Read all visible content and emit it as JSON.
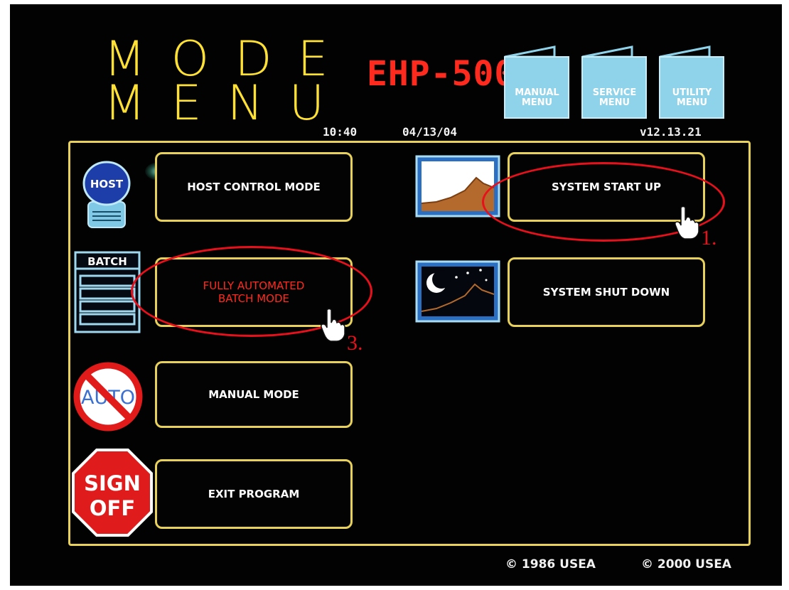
{
  "header": {
    "title_line1": "MODE",
    "title_line2": "MENU",
    "model": "EHP-500",
    "time": "10:40",
    "date": "04/13/04",
    "version": "v12.13.21"
  },
  "top_menus": [
    {
      "label": "MANUAL\nMENU"
    },
    {
      "label": "SERVICE\nMENU"
    },
    {
      "label": "UTILITY\nMENU"
    }
  ],
  "modes": {
    "host": {
      "label": "HOST CONTROL MODE",
      "icon_label": "HOST",
      "icon": "host-computer-icon"
    },
    "batch": {
      "label": "FULLY AUTOMATED\nBATCH MODE",
      "icon_label": "BATCH",
      "icon": "batch-list-icon"
    },
    "manual": {
      "label": "MANUAL MODE",
      "icon_label": "AUTO",
      "icon": "no-auto-icon"
    },
    "exit": {
      "label": "EXIT PROGRAM",
      "icon_label_1": "SIGN",
      "icon_label_2": "OFF",
      "icon": "stop-sign-icon"
    },
    "startup": {
      "label": "SYSTEM START UP",
      "icon": "sunrise-mountain-icon"
    },
    "shutdown": {
      "label": "SYSTEM SHUT DOWN",
      "icon": "night-moon-icon"
    }
  },
  "annotations": {
    "startup_number": "1.",
    "batch_number": "3."
  },
  "footer": {
    "copyright1": "© 1986 USEA",
    "copyright2": "© 2000 USEA"
  },
  "colors": {
    "background": "#020202",
    "title": "#ffe135",
    "model": "#ff2a1e",
    "border": "#e8d15a",
    "menu_fill": "#8fd3ea",
    "annotation": "#e8101a"
  }
}
